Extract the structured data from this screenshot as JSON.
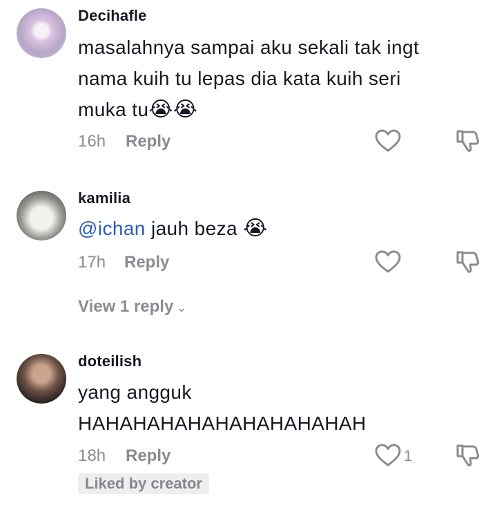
{
  "comments": [
    {
      "username": "Decihafle",
      "lines": [
        "masalahnya sampai aku sekali tak ingt",
        "nama kuih tu lepas dia kata kuih seri",
        "muka tu"
      ],
      "emoji": "😭😭",
      "time": "16h",
      "reply_label": "Reply",
      "avatar_icon": "flower-bouquet-avatar"
    },
    {
      "username": "kamilia",
      "mention": "@ichan",
      "text": "jauh beza",
      "emoji": "😭",
      "time": "17h",
      "reply_label": "Reply",
      "view_replies": "View 1 reply",
      "avatar_icon": "cat-avatar"
    },
    {
      "username": "doteilish",
      "lines": [
        "yang angguk",
        "HAHAHAHAHAHAHAHAHAHAH"
      ],
      "time": "18h",
      "reply_label": "Reply",
      "like_count": "1",
      "badge": "Liked by creator",
      "avatar_icon": "person-avatar"
    }
  ],
  "colors": {
    "text": "#161823",
    "muted": "#8a8b91",
    "mention": "#2b5db9",
    "badge_bg": "#eeeeef"
  }
}
